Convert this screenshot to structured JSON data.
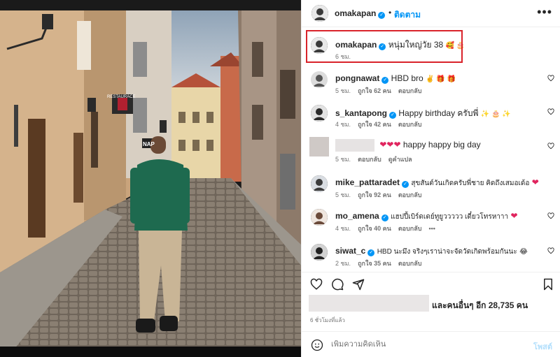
{
  "post_header": {
    "username": "omakapan",
    "separator": "•",
    "follow_label": "ติดตาม",
    "more_label": "•••"
  },
  "caption": {
    "username": "omakapan",
    "text": "หนุ่มใหญ่วัย 38",
    "emoji": "🥰 🎂",
    "time": "6 ชม."
  },
  "comments": [
    {
      "username": "pongnawat",
      "text": "HBD bro",
      "emoji": "✌️ 🎁 🎁",
      "time": "5 ชม.",
      "likes": "ถูกใจ 62 คน",
      "reply": "ตอบกลับ"
    },
    {
      "username": "s_kantapong",
      "text": "Happy birthday ครับพี่",
      "emoji": "✨ 🎂 ✨",
      "time": "4 ชม.",
      "likes": "ถูกใจ 42 คน",
      "reply": "ตอบกลับ"
    },
    {
      "username": "",
      "text": "happy happy big day",
      "emoji": "❤❤❤",
      "time": "5 ชม.",
      "likes": "ตอบกลับ",
      "reply": "ดูคำแปล"
    },
    {
      "username": "mike_pattaradet",
      "text": "สุขสันต์วันเกิดครับพี่ชาย คิดถึงเสมอเด้อ",
      "emoji": "❤",
      "time": "5 ชม.",
      "likes": "ถูกใจ 92 คน",
      "reply": "ตอบกลับ"
    },
    {
      "username": "mo_amena",
      "text": "แฮปปี้เบิร์ดเดย์ทูยูววววว เดี๋ยวโทรหาาา",
      "emoji": "❤",
      "time": "4 ชม.",
      "likes": "ถูกใจ 40 คน",
      "reply": "ตอบกลับ",
      "more": "•••"
    },
    {
      "username": "siwat_c",
      "text": "HBD นะมึง จริงๆเราน่าจะจัดวัดเกิดพร้อมกันนะ",
      "emoji": "😂",
      "time": "2 ชม.",
      "likes": "ถูกใจ 35 คน",
      "reply": "ตอบกลับ"
    }
  ],
  "likes": {
    "text": "และคนอื่นๆ อีก 28,735 คน"
  },
  "posted_time": "6 ชั่วโมงที่แล้ว",
  "add_comment": {
    "placeholder": "เพิ่มความคิดเห็น",
    "post_label": "โพสต์"
  },
  "photo_signs": {
    "restaurace": "RESTAURACE",
    "nap": "NAP"
  },
  "colors": {
    "accent_blue": "#0095f6",
    "highlight_red": "#d9232a"
  }
}
